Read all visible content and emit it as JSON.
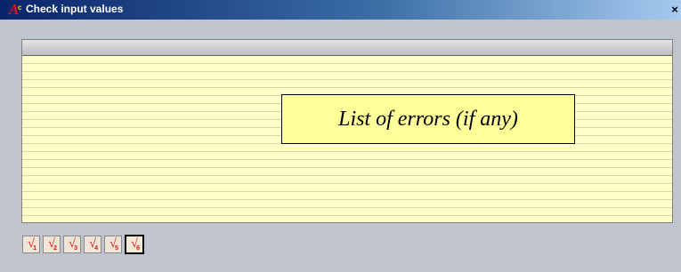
{
  "window": {
    "title": "Check input values",
    "icon": "app-icon",
    "close_label": "×"
  },
  "list": {
    "placeholder_text": "List of errors (if any)",
    "colors": {
      "background": "#ffffc8",
      "callout": "#ffff99"
    }
  },
  "check_buttons": [
    {
      "glyph": "√",
      "number": "1"
    },
    {
      "glyph": "√",
      "number": "2"
    },
    {
      "glyph": "√",
      "number": "3"
    },
    {
      "glyph": "√",
      "number": "4"
    },
    {
      "glyph": "√",
      "number": "5"
    },
    {
      "glyph": "√",
      "number": "6",
      "selected": true
    }
  ]
}
